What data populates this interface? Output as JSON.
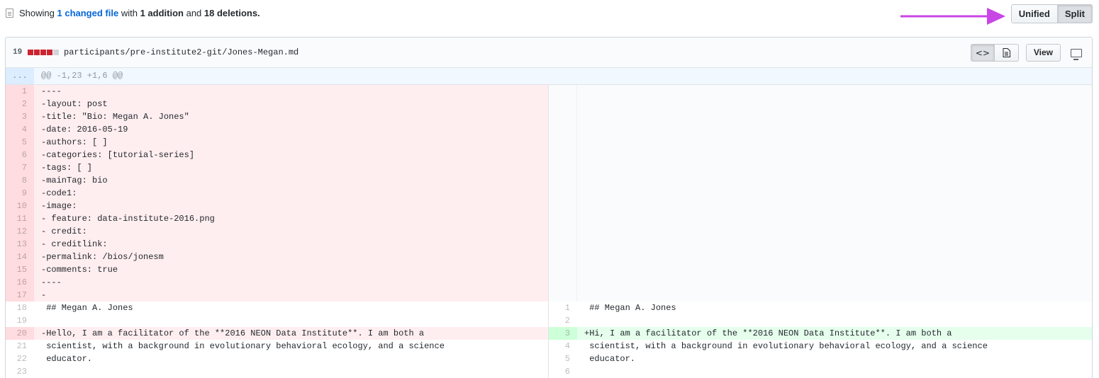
{
  "summary": {
    "prefix": "Showing",
    "changed": "1 changed file",
    "with": "with",
    "additions": "1 addition",
    "and": "and",
    "deletions": "18 deletions."
  },
  "toggle": {
    "unified": "Unified",
    "split": "Split"
  },
  "annotation_arrow_color": "#c846e6",
  "file": {
    "stat_count": "19",
    "stat_blocks": {
      "deleted": 4,
      "neutral": 1
    },
    "path": "participants/pre-institute2-git/Jones-Megan.md",
    "view_label": "View",
    "code_icon": "code-icon",
    "rich_icon": "file-text-icon",
    "display_icon": "desktop-icon"
  },
  "hunk": {
    "expander": "...",
    "header": "@@ -1,23 +1,6 @@"
  },
  "left_lines": [
    {
      "n": "1",
      "type": "del",
      "text": "----"
    },
    {
      "n": "2",
      "type": "del",
      "text": "-layout: post"
    },
    {
      "n": "3",
      "type": "del",
      "text": "-title: \"Bio: Megan A. Jones\""
    },
    {
      "n": "4",
      "type": "del",
      "text": "-date: 2016-05-19"
    },
    {
      "n": "5",
      "type": "del",
      "text": "-authors: [ ]"
    },
    {
      "n": "6",
      "type": "del",
      "text": "-categories: [tutorial-series]"
    },
    {
      "n": "7",
      "type": "del",
      "text": "-tags: [ ]"
    },
    {
      "n": "8",
      "type": "del",
      "text": "-mainTag: bio"
    },
    {
      "n": "9",
      "type": "del",
      "text": "-code1:"
    },
    {
      "n": "10",
      "type": "del",
      "text": "-image:"
    },
    {
      "n": "11",
      "type": "del",
      "text": "- feature: data-institute-2016.png"
    },
    {
      "n": "12",
      "type": "del",
      "text": "- credit:"
    },
    {
      "n": "13",
      "type": "del",
      "text": "- creditlink:"
    },
    {
      "n": "14",
      "type": "del",
      "text": "-permalink: /bios/jonesm"
    },
    {
      "n": "15",
      "type": "del",
      "text": "-comments: true"
    },
    {
      "n": "16",
      "type": "del",
      "text": "----"
    },
    {
      "n": "17",
      "type": "del",
      "text": "-"
    },
    {
      "n": "18",
      "type": "ctx",
      "text": " ## Megan A. Jones"
    },
    {
      "n": "19",
      "type": "ctx",
      "text": ""
    },
    {
      "n": "20",
      "type": "del",
      "text": "-Hello, I am a facilitator of the **2016 NEON Data Institute**. I am both a"
    },
    {
      "n": "21",
      "type": "ctx",
      "text": " scientist, with a background in evolutionary behavioral ecology, and a science"
    },
    {
      "n": "22",
      "type": "ctx",
      "text": " educator."
    },
    {
      "n": "23",
      "type": "ctx",
      "text": ""
    }
  ],
  "right_lines": [
    {
      "n": "",
      "type": "empty",
      "text": ""
    },
    {
      "n": "",
      "type": "empty",
      "text": ""
    },
    {
      "n": "",
      "type": "empty",
      "text": ""
    },
    {
      "n": "",
      "type": "empty",
      "text": ""
    },
    {
      "n": "",
      "type": "empty",
      "text": ""
    },
    {
      "n": "",
      "type": "empty",
      "text": ""
    },
    {
      "n": "",
      "type": "empty",
      "text": ""
    },
    {
      "n": "",
      "type": "empty",
      "text": ""
    },
    {
      "n": "",
      "type": "empty",
      "text": ""
    },
    {
      "n": "",
      "type": "empty",
      "text": ""
    },
    {
      "n": "",
      "type": "empty",
      "text": ""
    },
    {
      "n": "",
      "type": "empty",
      "text": ""
    },
    {
      "n": "",
      "type": "empty",
      "text": ""
    },
    {
      "n": "",
      "type": "empty",
      "text": ""
    },
    {
      "n": "",
      "type": "empty",
      "text": ""
    },
    {
      "n": "",
      "type": "empty",
      "text": ""
    },
    {
      "n": "",
      "type": "empty",
      "text": ""
    },
    {
      "n": "1",
      "type": "ctx",
      "text": " ## Megan A. Jones"
    },
    {
      "n": "2",
      "type": "ctx",
      "text": ""
    },
    {
      "n": "3",
      "type": "add",
      "text": "+Hi, I am a facilitator of the **2016 NEON Data Institute**. I am both a"
    },
    {
      "n": "4",
      "type": "ctx",
      "text": " scientist, with a background in evolutionary behavioral ecology, and a science"
    },
    {
      "n": "5",
      "type": "ctx",
      "text": " educator."
    },
    {
      "n": "6",
      "type": "ctx",
      "text": ""
    }
  ]
}
